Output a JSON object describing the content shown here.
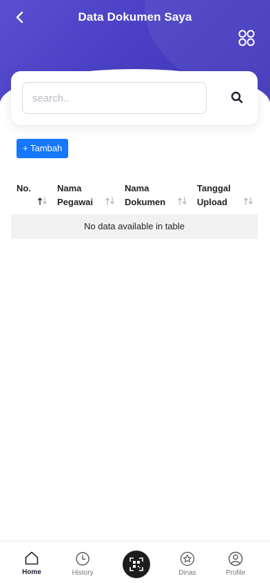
{
  "header": {
    "title": "Data Dokumen Saya",
    "back_icon": "chevron-left-icon",
    "menu_icon": "grid-circles-icon",
    "gradient": [
      "#5a4fd0",
      "#3f35b8"
    ]
  },
  "search": {
    "placeholder": "search..",
    "value": "",
    "icon": "search-icon"
  },
  "actions": {
    "add_label": "+ Tambah",
    "add_color": "#1677ff"
  },
  "table": {
    "columns": [
      {
        "line1": "No.",
        "line2": ""
      },
      {
        "line1": "Nama",
        "line2": "Pegawai"
      },
      {
        "line1": "Nama",
        "line2": "Dokumen"
      },
      {
        "line1": "Tanggal",
        "line2": "Upload"
      }
    ],
    "empty_message": "No data available in table"
  },
  "bottom_nav": {
    "items": [
      {
        "label": "Home",
        "icon": "home-icon",
        "active": true
      },
      {
        "label": "History",
        "icon": "clock-icon",
        "active": false
      },
      {
        "label": "",
        "icon": "qr-scan-icon",
        "active": false
      },
      {
        "label": "Dinas",
        "icon": "star-badge-icon",
        "active": false
      },
      {
        "label": "Profile",
        "icon": "user-icon",
        "active": false
      }
    ]
  }
}
